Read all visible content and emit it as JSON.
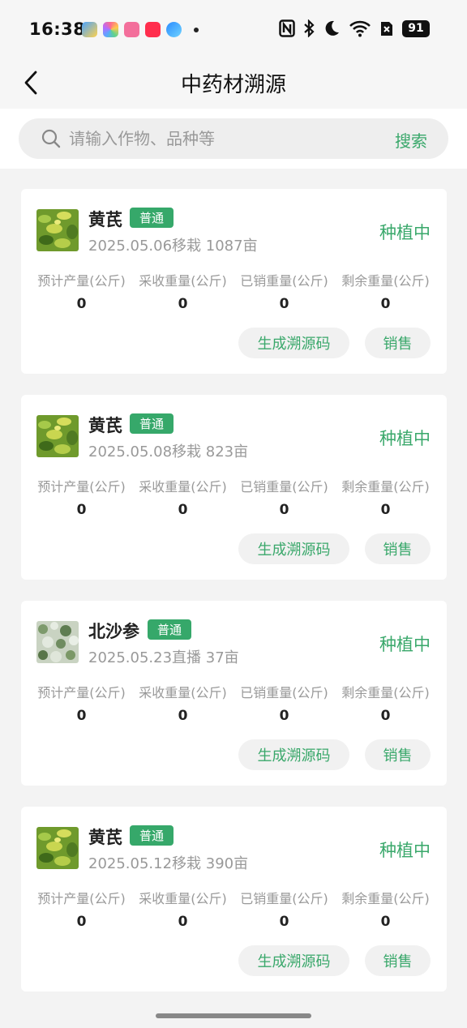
{
  "status_bar": {
    "time": "16:38",
    "battery": "91",
    "app_icons": [
      "weather-app-icon",
      "gallery-app-icon",
      "bilibili-app-icon",
      "xiaohongshu-app-icon",
      "browser-app-icon"
    ],
    "system_icons": [
      "nfc-icon",
      "bluetooth-icon",
      "moon-icon",
      "wifi-icon",
      "sim-icon",
      "battery-icon"
    ]
  },
  "header": {
    "title": "中药材溯源",
    "back_icon": "chevron-left-icon"
  },
  "search": {
    "placeholder": "请输入作物、品种等",
    "value": "",
    "button_label": "搜索"
  },
  "stat_labels": [
    "预计产量(公斤)",
    "采收重量(公斤)",
    "已销重量(公斤)",
    "剩余重量(公斤)"
  ],
  "cards": [
    {
      "name": "黄芪",
      "tag": "普通",
      "meta": "2025.05.06移栽  1087亩",
      "status": "种植中",
      "image": "astragalus-plant-thumbnail",
      "stats": [
        "0",
        "0",
        "0",
        "0"
      ],
      "trace_label": "生成溯源码",
      "sell_label": "销售"
    },
    {
      "name": "黄芪",
      "tag": "普通",
      "meta": "2025.05.08移栽  823亩",
      "status": "种植中",
      "image": "astragalus-plant-thumbnail",
      "stats": [
        "0",
        "0",
        "0",
        "0"
      ],
      "trace_label": "生成溯源码",
      "sell_label": "销售"
    },
    {
      "name": "北沙参",
      "tag": "普通",
      "meta": "2025.05.23直播  37亩",
      "status": "种植中",
      "image": "glehnia-plant-thumbnail",
      "stats": [
        "0",
        "0",
        "0",
        "0"
      ],
      "trace_label": "生成溯源码",
      "sell_label": "销售"
    },
    {
      "name": "黄芪",
      "tag": "普通",
      "meta": "2025.05.12移栽  390亩",
      "status": "种植中",
      "image": "astragalus-plant-thumbnail",
      "stats": [
        "0",
        "0",
        "0",
        "0"
      ],
      "trace_label": "生成溯源码",
      "sell_label": "销售"
    }
  ],
  "colors": {
    "accent": "#3aa86b",
    "tag_bg": "#36a86a",
    "muted_text": "#999999"
  }
}
